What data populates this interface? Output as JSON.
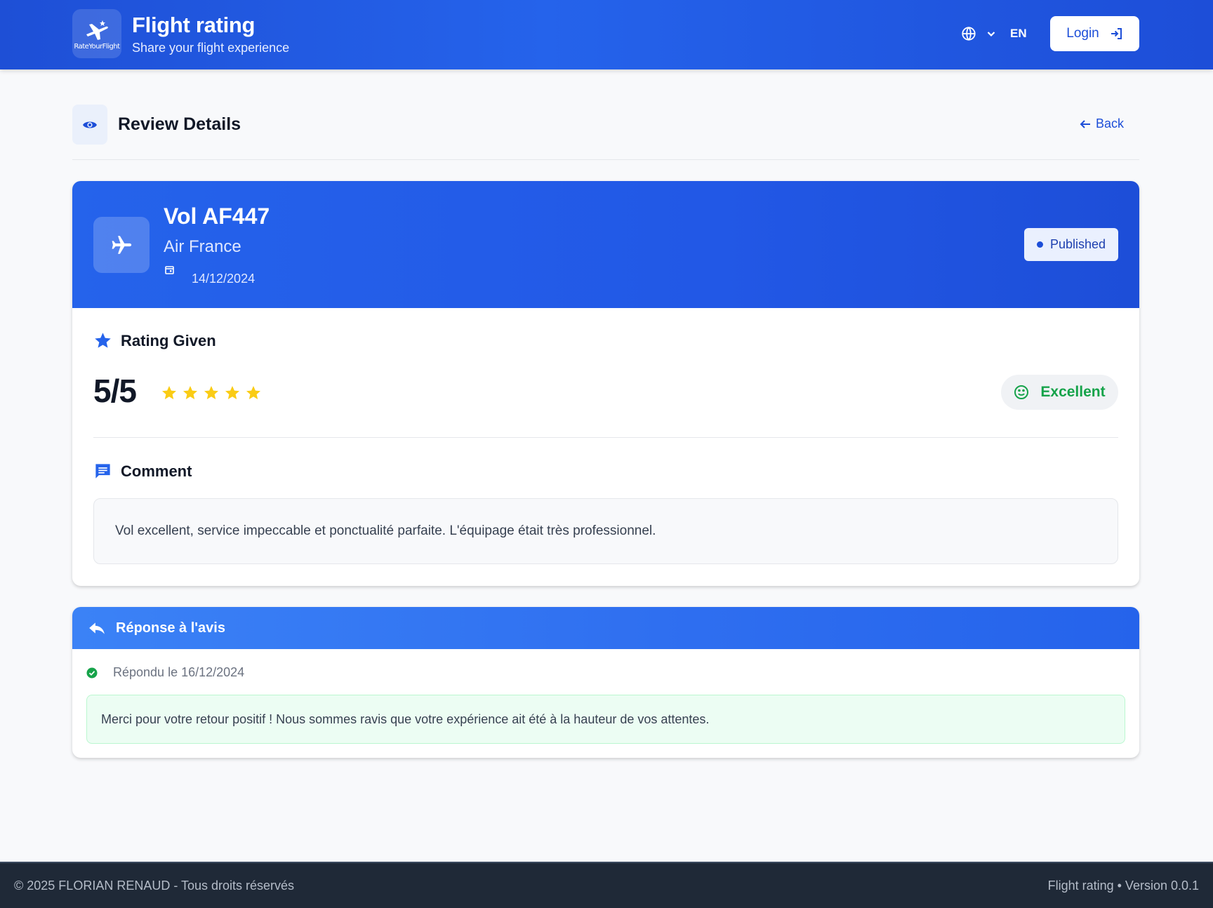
{
  "header": {
    "logo_text": "RateYourFlight",
    "title": "Flight rating",
    "subtitle": "Share your flight experience",
    "language_code": "EN",
    "login_label": "Login"
  },
  "page": {
    "title": "Review Details",
    "back_label": "Back"
  },
  "flight": {
    "number": "Vol AF447",
    "airline": "Air France",
    "date": "14/12/2024",
    "status": "Published"
  },
  "rating": {
    "section_title": "Rating Given",
    "score": "5/5",
    "stars_filled": 5,
    "stars_total": 5,
    "verdict": "Excellent"
  },
  "comment": {
    "section_title": "Comment",
    "text": "Vol excellent, service impeccable et ponctualité parfaite. L'équipage était très professionnel."
  },
  "response": {
    "section_title": "Réponse à l'avis",
    "answered_label": "Répondu le 16/12/2024",
    "text": "Merci pour votre retour positif ! Nous sommes ravis que votre expérience ait été à la hauteur de vos attentes."
  },
  "footer": {
    "copyright": "© 2025 FLORIAN RENAUD - Tous droits réservés",
    "version": "Flight rating • Version 0.0.1"
  },
  "colors": {
    "primary": "#2563eb",
    "primary_dark": "#1d4ed8",
    "star": "#facc15",
    "success": "#16a34a",
    "footer_bg": "#1f2937"
  },
  "icons": {
    "logo": "plane-logo-icon",
    "language": "globe-icon",
    "dropdown": "chevron-down-icon",
    "login": "login-icon",
    "page": "eye-icon",
    "back": "arrow-left-icon",
    "flight": "airplane-icon",
    "date": "calendar-icon",
    "rating": "star-icon",
    "verdict": "smiley-icon",
    "comment": "comment-icon",
    "response": "reply-icon",
    "answered": "check-circle-icon"
  }
}
